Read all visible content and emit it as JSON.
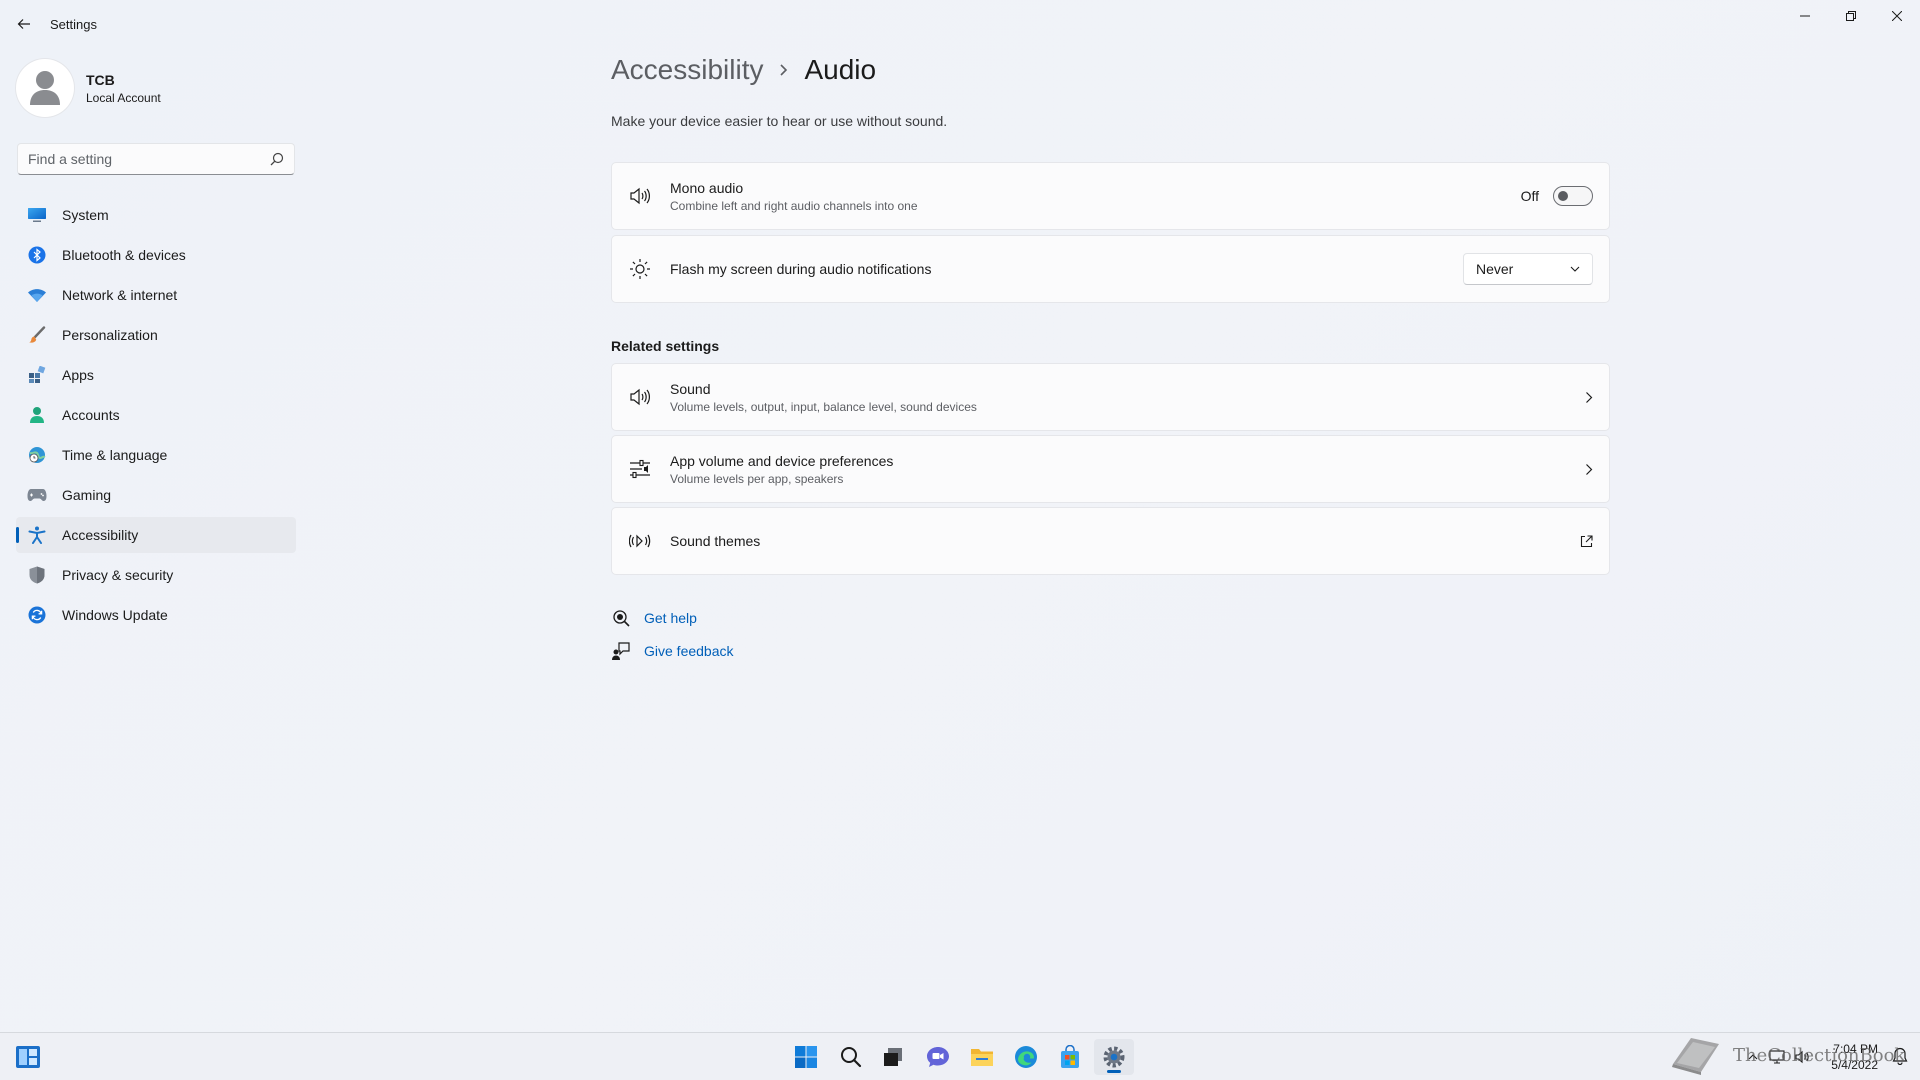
{
  "window": {
    "title": "Settings"
  },
  "profile": {
    "name": "TCB",
    "account_type": "Local Account"
  },
  "search": {
    "placeholder": "Find a setting"
  },
  "sidebar": {
    "items": [
      {
        "label": "System",
        "icon": "monitor-icon",
        "selected": false
      },
      {
        "label": "Bluetooth & devices",
        "icon": "bluetooth-icon",
        "selected": false
      },
      {
        "label": "Network & internet",
        "icon": "wifi-icon",
        "selected": false
      },
      {
        "label": "Personalization",
        "icon": "brush-icon",
        "selected": false
      },
      {
        "label": "Apps",
        "icon": "apps-icon",
        "selected": false
      },
      {
        "label": "Accounts",
        "icon": "person-icon",
        "selected": false
      },
      {
        "label": "Time & language",
        "icon": "globe-clock-icon",
        "selected": false
      },
      {
        "label": "Gaming",
        "icon": "gamepad-icon",
        "selected": false
      },
      {
        "label": "Accessibility",
        "icon": "accessibility-icon",
        "selected": true
      },
      {
        "label": "Privacy & security",
        "icon": "shield-icon",
        "selected": false
      },
      {
        "label": "Windows Update",
        "icon": "update-icon",
        "selected": false
      }
    ]
  },
  "breadcrumb": {
    "parent": "Accessibility",
    "current": "Audio"
  },
  "page": {
    "description": "Make your device easier to hear or use without sound."
  },
  "settings": {
    "mono_audio": {
      "title": "Mono audio",
      "subtitle": "Combine left and right audio channels into one",
      "state_label": "Off"
    },
    "flash_screen": {
      "title": "Flash my screen during audio notifications",
      "selected_option": "Never"
    }
  },
  "related": {
    "heading": "Related settings",
    "items": [
      {
        "title": "Sound",
        "subtitle": "Volume levels, output, input, balance level, sound devices"
      },
      {
        "title": "App volume and device preferences",
        "subtitle": "Volume levels per app, speakers"
      },
      {
        "title": "Sound themes",
        "subtitle": ""
      }
    ]
  },
  "help": {
    "get_help": "Get help",
    "give_feedback": "Give feedback"
  },
  "taskbar": {
    "time": "7:04 PM",
    "date": "5/4/2022"
  },
  "watermark": {
    "text": "TheCollectionBook"
  },
  "colors": {
    "accent": "#005fb8"
  }
}
